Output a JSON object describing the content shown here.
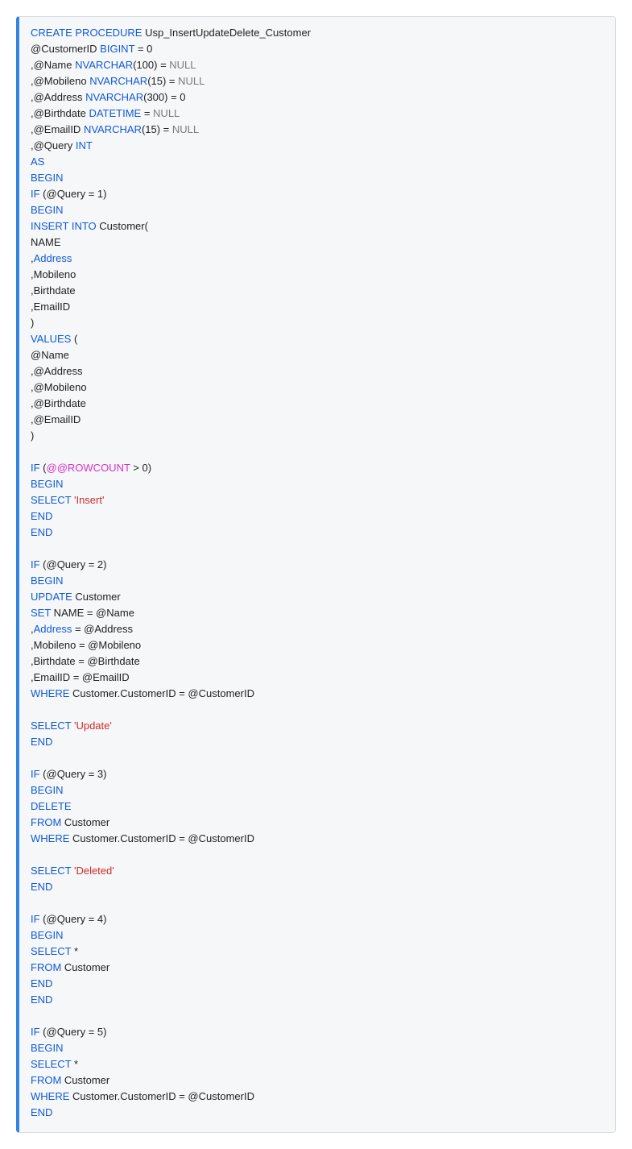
{
  "code": {
    "lines": [
      [
        {
          "c": "kw",
          "t": "CREATE"
        },
        {
          "c": "txt",
          "t": " "
        },
        {
          "c": "kw",
          "t": "PROCEDURE"
        },
        {
          "c": "txt",
          "t": " Usp_InsertUpdateDelete_Customer"
        }
      ],
      [
        {
          "c": "txt",
          "t": "@CustomerID "
        },
        {
          "c": "kw",
          "t": "BIGINT"
        },
        {
          "c": "txt",
          "t": " = 0"
        }
      ],
      [
        {
          "c": "txt",
          "t": ",@Name "
        },
        {
          "c": "kw",
          "t": "NVARCHAR"
        },
        {
          "c": "txt",
          "t": "(100) = "
        },
        {
          "c": "gray",
          "t": "NULL"
        }
      ],
      [
        {
          "c": "txt",
          "t": ",@Mobileno "
        },
        {
          "c": "kw",
          "t": "NVARCHAR"
        },
        {
          "c": "txt",
          "t": "(15) = "
        },
        {
          "c": "gray",
          "t": "NULL"
        }
      ],
      [
        {
          "c": "txt",
          "t": ",@Address "
        },
        {
          "c": "kw",
          "t": "NVARCHAR"
        },
        {
          "c": "txt",
          "t": "(300) = 0"
        }
      ],
      [
        {
          "c": "txt",
          "t": ",@Birthdate "
        },
        {
          "c": "kw",
          "t": "DATETIME"
        },
        {
          "c": "txt",
          "t": " = "
        },
        {
          "c": "gray",
          "t": "NULL"
        }
      ],
      [
        {
          "c": "txt",
          "t": ",@EmailID "
        },
        {
          "c": "kw",
          "t": "NVARCHAR"
        },
        {
          "c": "txt",
          "t": "(15) = "
        },
        {
          "c": "gray",
          "t": "NULL"
        }
      ],
      [
        {
          "c": "txt",
          "t": ",@Query "
        },
        {
          "c": "kw",
          "t": "INT"
        }
      ],
      [
        {
          "c": "kw",
          "t": "AS"
        }
      ],
      [
        {
          "c": "kw",
          "t": "BEGIN"
        }
      ],
      [
        {
          "c": "kw",
          "t": "IF"
        },
        {
          "c": "txt",
          "t": " (@Query = 1)"
        }
      ],
      [
        {
          "c": "kw",
          "t": "BEGIN"
        }
      ],
      [
        {
          "c": "kw",
          "t": "INSERT"
        },
        {
          "c": "txt",
          "t": " "
        },
        {
          "c": "kw",
          "t": "INTO"
        },
        {
          "c": "txt",
          "t": " Customer("
        }
      ],
      [
        {
          "c": "txt",
          "t": "NAME"
        }
      ],
      [
        {
          "c": "txt",
          "t": ","
        },
        {
          "c": "kw",
          "t": "Address"
        }
      ],
      [
        {
          "c": "txt",
          "t": ",Mobileno"
        }
      ],
      [
        {
          "c": "txt",
          "t": ",Birthdate"
        }
      ],
      [
        {
          "c": "txt",
          "t": ",EmailID"
        }
      ],
      [
        {
          "c": "txt",
          "t": ")"
        }
      ],
      [
        {
          "c": "kw",
          "t": "VALUES"
        },
        {
          "c": "txt",
          "t": " ("
        }
      ],
      [
        {
          "c": "txt",
          "t": "@Name"
        }
      ],
      [
        {
          "c": "txt",
          "t": ",@Address"
        }
      ],
      [
        {
          "c": "txt",
          "t": ",@Mobileno"
        }
      ],
      [
        {
          "c": "txt",
          "t": ",@Birthdate"
        }
      ],
      [
        {
          "c": "txt",
          "t": ",@EmailID"
        }
      ],
      [
        {
          "c": "txt",
          "t": ")"
        }
      ],
      [
        {
          "c": "txt",
          "t": ""
        }
      ],
      [
        {
          "c": "kw",
          "t": "IF"
        },
        {
          "c": "txt",
          "t": " ("
        },
        {
          "c": "mag",
          "t": "@@ROWCOUNT"
        },
        {
          "c": "txt",
          "t": " > 0)"
        }
      ],
      [
        {
          "c": "kw",
          "t": "BEGIN"
        }
      ],
      [
        {
          "c": "kw",
          "t": "SELECT"
        },
        {
          "c": "txt",
          "t": " "
        },
        {
          "c": "str",
          "t": "'Insert'"
        }
      ],
      [
        {
          "c": "kw",
          "t": "END"
        }
      ],
      [
        {
          "c": "kw",
          "t": "END"
        }
      ],
      [
        {
          "c": "txt",
          "t": ""
        }
      ],
      [
        {
          "c": "kw",
          "t": "IF"
        },
        {
          "c": "txt",
          "t": " (@Query = 2)"
        }
      ],
      [
        {
          "c": "kw",
          "t": "BEGIN"
        }
      ],
      [
        {
          "c": "kw",
          "t": "UPDATE"
        },
        {
          "c": "txt",
          "t": " Customer"
        }
      ],
      [
        {
          "c": "kw",
          "t": "SET"
        },
        {
          "c": "txt",
          "t": " NAME = @Name"
        }
      ],
      [
        {
          "c": "txt",
          "t": ","
        },
        {
          "c": "kw",
          "t": "Address"
        },
        {
          "c": "txt",
          "t": " = @Address"
        }
      ],
      [
        {
          "c": "txt",
          "t": ",Mobileno = @Mobileno"
        }
      ],
      [
        {
          "c": "txt",
          "t": ",Birthdate = @Birthdate"
        }
      ],
      [
        {
          "c": "txt",
          "t": ",EmailID = @EmailID"
        }
      ],
      [
        {
          "c": "kw",
          "t": "WHERE"
        },
        {
          "c": "txt",
          "t": " Customer.CustomerID = @CustomerID"
        }
      ],
      [
        {
          "c": "txt",
          "t": ""
        }
      ],
      [
        {
          "c": "kw",
          "t": "SELECT"
        },
        {
          "c": "txt",
          "t": " "
        },
        {
          "c": "str",
          "t": "'Update'"
        }
      ],
      [
        {
          "c": "kw",
          "t": "END"
        }
      ],
      [
        {
          "c": "txt",
          "t": ""
        }
      ],
      [
        {
          "c": "kw",
          "t": "IF"
        },
        {
          "c": "txt",
          "t": " (@Query = 3)"
        }
      ],
      [
        {
          "c": "kw",
          "t": "BEGIN"
        }
      ],
      [
        {
          "c": "kw",
          "t": "DELETE"
        }
      ],
      [
        {
          "c": "kw",
          "t": "FROM"
        },
        {
          "c": "txt",
          "t": " Customer"
        }
      ],
      [
        {
          "c": "kw",
          "t": "WHERE"
        },
        {
          "c": "txt",
          "t": " Customer.CustomerID = @CustomerID"
        }
      ],
      [
        {
          "c": "txt",
          "t": ""
        }
      ],
      [
        {
          "c": "kw",
          "t": "SELECT"
        },
        {
          "c": "txt",
          "t": " "
        },
        {
          "c": "str",
          "t": "'Deleted'"
        }
      ],
      [
        {
          "c": "kw",
          "t": "END"
        }
      ],
      [
        {
          "c": "txt",
          "t": ""
        }
      ],
      [
        {
          "c": "kw",
          "t": "IF"
        },
        {
          "c": "txt",
          "t": " (@Query = 4)"
        }
      ],
      [
        {
          "c": "kw",
          "t": "BEGIN"
        }
      ],
      [
        {
          "c": "kw",
          "t": "SELECT"
        },
        {
          "c": "txt",
          "t": " *"
        }
      ],
      [
        {
          "c": "kw",
          "t": "FROM"
        },
        {
          "c": "txt",
          "t": " Customer"
        }
      ],
      [
        {
          "c": "kw",
          "t": "END"
        }
      ],
      [
        {
          "c": "kw",
          "t": "END"
        }
      ],
      [
        {
          "c": "txt",
          "t": ""
        }
      ],
      [
        {
          "c": "kw",
          "t": "IF"
        },
        {
          "c": "txt",
          "t": " (@Query = 5)"
        }
      ],
      [
        {
          "c": "kw",
          "t": "BEGIN"
        }
      ],
      [
        {
          "c": "kw",
          "t": "SELECT"
        },
        {
          "c": "txt",
          "t": " *"
        }
      ],
      [
        {
          "c": "kw",
          "t": "FROM"
        },
        {
          "c": "txt",
          "t": " Customer"
        }
      ],
      [
        {
          "c": "kw",
          "t": "WHERE"
        },
        {
          "c": "txt",
          "t": " Customer.CustomerID = @CustomerID"
        }
      ],
      [
        {
          "c": "kw",
          "t": "END"
        }
      ]
    ]
  }
}
